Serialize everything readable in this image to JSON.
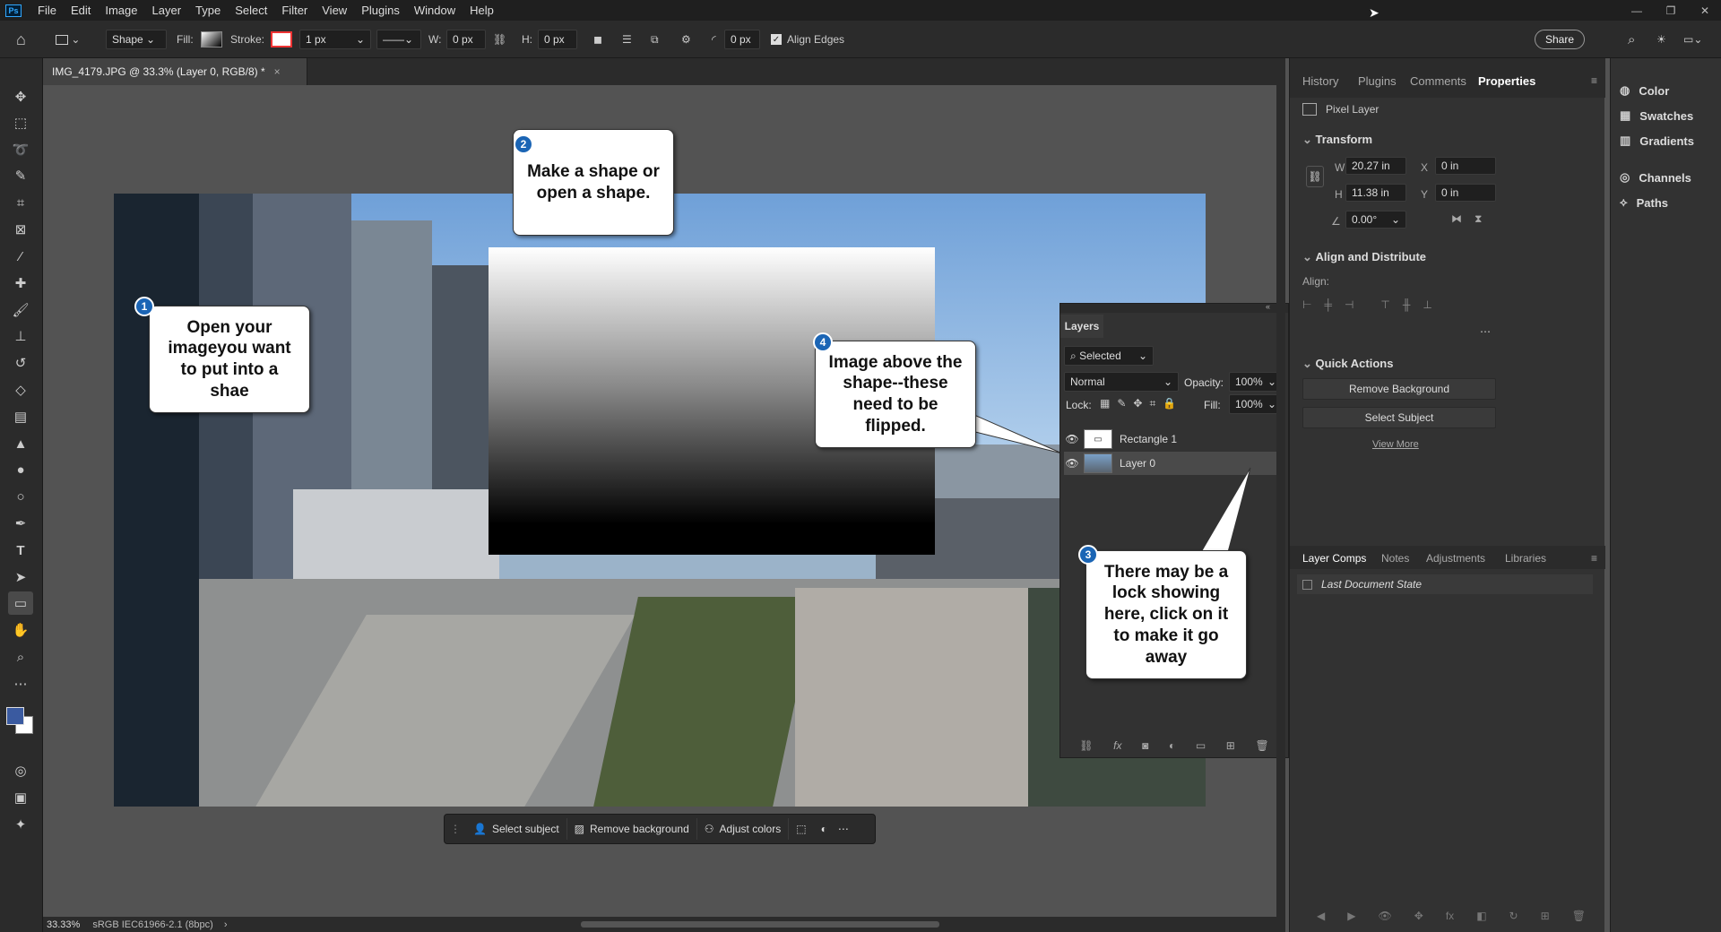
{
  "menubar": {
    "logo": "Ps",
    "items": [
      "File",
      "Edit",
      "Image",
      "Layer",
      "Type",
      "Select",
      "Filter",
      "View",
      "Plugins",
      "Window",
      "Help"
    ]
  },
  "options": {
    "tool_mode": "Shape",
    "fill_label": "Fill:",
    "stroke_label": "Stroke:",
    "stroke_width": "1 px",
    "w_label": "W:",
    "w_value": "0 px",
    "h_label": "H:",
    "h_value": "0 px",
    "radius_value": "0 px",
    "align_edges": "Align Edges",
    "share": "Share"
  },
  "document": {
    "tab_title": "IMG_4179.JPG @ 33.3% (Layer 0, RGB/8) *",
    "zoom": "33.33%",
    "profile": "sRGB IEC61966-2.1 (8bpc)"
  },
  "callouts": [
    {
      "num": "1",
      "text": "Open your imageyou want to put into a shae"
    },
    {
      "num": "2",
      "text": "Make a shape or open a shape."
    },
    {
      "num": "3",
      "text": "There may be a lock showing here, click on it to make it go away"
    },
    {
      "num": "4",
      "text": "Image above the shape--these need to be flipped."
    }
  ],
  "contextbar": {
    "select_subject": "Select subject",
    "remove_background": "Remove background",
    "adjust_colors": "Adjust colors"
  },
  "layers_panel": {
    "title": "Layers",
    "filter": "Selected",
    "blend_mode": "Normal",
    "opacity_label": "Opacity:",
    "opacity": "100%",
    "lock_label": "Lock:",
    "fill_label": "Fill:",
    "fill": "100%",
    "layers": [
      {
        "name": "Rectangle 1"
      },
      {
        "name": "Layer 0"
      }
    ]
  },
  "properties": {
    "tabs": [
      "History",
      "Plugins",
      "Comments",
      "Properties"
    ],
    "pixel_layer": "Pixel Layer",
    "transform": "Transform",
    "w_label": "W",
    "w": "20.27 in",
    "x_label": "X",
    "x": "0 in",
    "h_label": "H",
    "h": "11.38 in",
    "y_label": "Y",
    "y": "0 in",
    "angle": "0.00°",
    "align_distribute": "Align and Distribute",
    "align_label": "Align:",
    "quick_actions": "Quick Actions",
    "remove_bg": "Remove Background",
    "select_subject": "Select Subject",
    "view_more": "View More"
  },
  "bottom_panel": {
    "tabs": [
      "Layer Comps",
      "Notes",
      "Adjustments",
      "Libraries"
    ],
    "state": "Last Document State"
  },
  "side_panels": [
    "Color",
    "Swatches",
    "Gradients",
    "Channels",
    "Paths"
  ],
  "colors": {
    "accent": "#1b65b5",
    "foreground_swatch": "#3a5aa0",
    "background_swatch": "#ffffff"
  }
}
